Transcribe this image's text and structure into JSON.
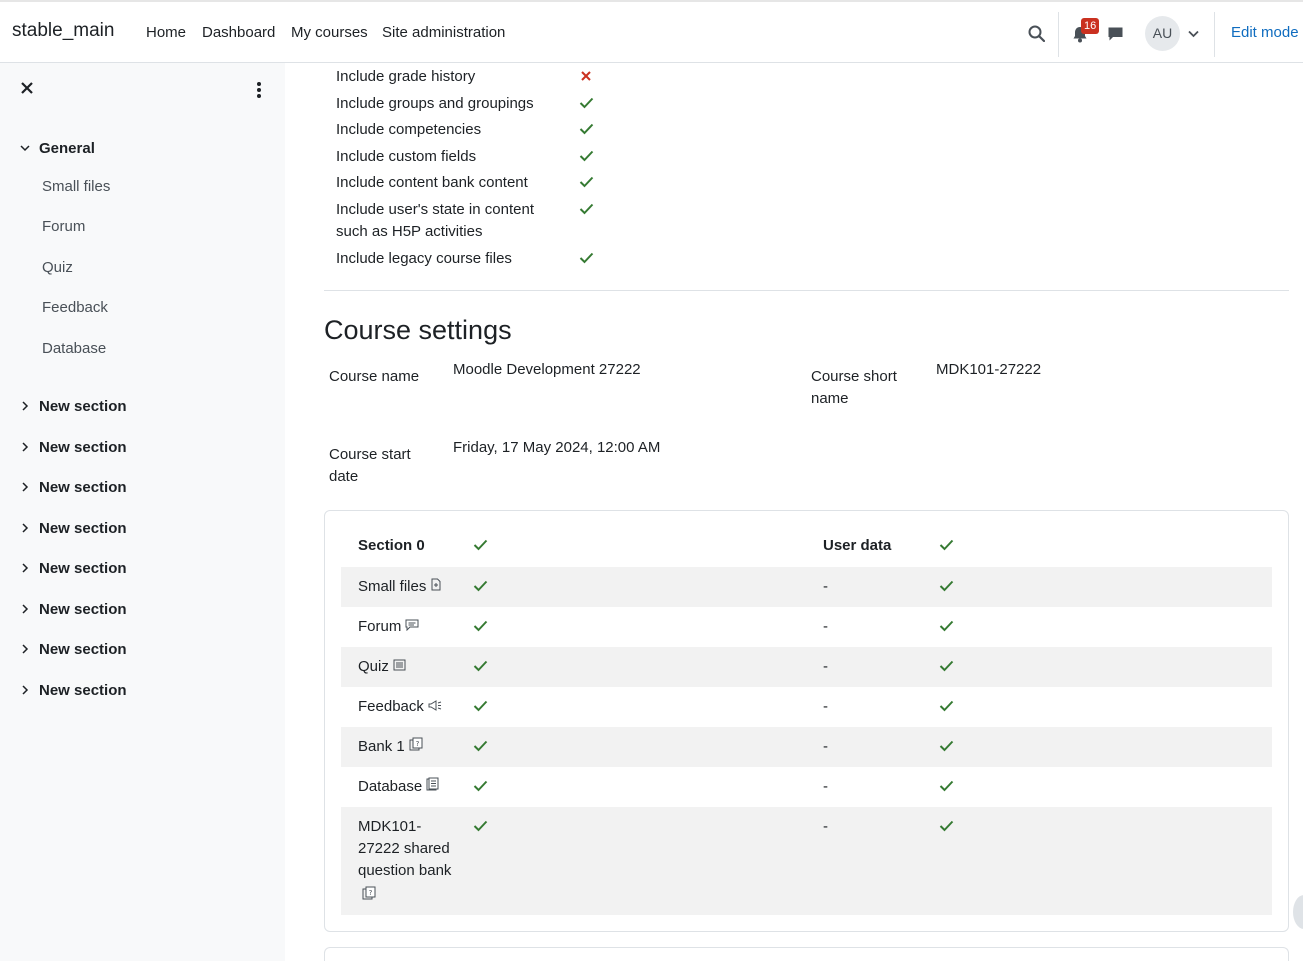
{
  "navbar": {
    "brand": "stable_main",
    "links": [
      "Home",
      "Dashboard",
      "My courses",
      "Site administration"
    ],
    "notification_count": "16",
    "avatar_initials": "AU",
    "edit_mode": "Edit mode"
  },
  "drawer": {
    "general": "General",
    "general_items": [
      "Small files",
      "Forum",
      "Quiz",
      "Feedback",
      "Database"
    ],
    "sections": [
      "New section",
      "New section",
      "New section",
      "New section",
      "New section",
      "New section",
      "New section",
      "New section"
    ]
  },
  "backup_options": [
    {
      "label": "Include grade history",
      "enabled": false
    },
    {
      "label": "Include groups and groupings",
      "enabled": true
    },
    {
      "label": "Include competencies",
      "enabled": true
    },
    {
      "label": "Include custom fields",
      "enabled": true
    },
    {
      "label": "Include content bank content",
      "enabled": true
    },
    {
      "label": "Include user's state in content such as H5P activities",
      "enabled": true
    },
    {
      "label": "Include legacy course files",
      "enabled": true
    }
  ],
  "course_settings": {
    "heading": "Course settings",
    "course_name_label": "Course name",
    "course_name": "Moodle Development 27222",
    "short_name_label": "Course short name",
    "short_name": "MDK101-27222",
    "start_date_label": "Course start date",
    "start_date": "Friday, 17 May 2024, 12:00 AM"
  },
  "section_table": {
    "header": "Section 0",
    "user_data_header": "User data",
    "rows": [
      {
        "name": "Small files",
        "icon": "file-icon",
        "user_data": "-"
      },
      {
        "name": "Forum",
        "icon": "forum-icon",
        "user_data": "-"
      },
      {
        "name": "Quiz",
        "icon": "quiz-icon",
        "user_data": "-"
      },
      {
        "name": "Feedback",
        "icon": "feedback-icon",
        "user_data": "-"
      },
      {
        "name": "Bank 1",
        "icon": "question-bank-icon",
        "user_data": "-"
      },
      {
        "name": "Database",
        "icon": "database-icon",
        "user_data": "-"
      },
      {
        "name": "MDK101-27222 shared question bank",
        "icon": "question-bank-icon",
        "user_data": "-"
      }
    ]
  },
  "colors": {
    "check": "#357a32",
    "cross": "#ca3120",
    "link": "#0f6cbf",
    "badge": "#ca3120"
  }
}
